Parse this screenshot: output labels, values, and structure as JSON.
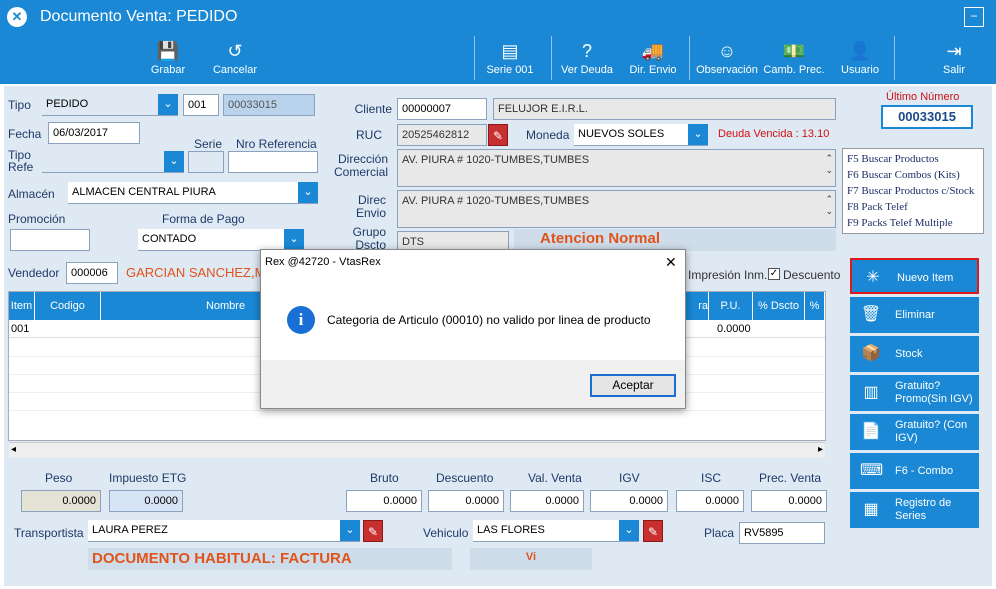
{
  "window": {
    "title": "Documento Venta: PEDIDO"
  },
  "toolbar": {
    "grabar": "Grabar",
    "cancelar": "Cancelar",
    "serie": "Serie 001",
    "ver_deuda": "Ver Deuda",
    "dir_envio": "Dir. Envio",
    "observacion": "Observación",
    "camb_prec": "Camb. Prec.",
    "usuario": "Usuario",
    "salir": "Salir"
  },
  "form": {
    "tipo_label": "Tipo",
    "tipo_value": "PEDIDO",
    "serie_value": "001",
    "numero_value": "00033015",
    "fecha_label": "Fecha",
    "fecha_value": "06/03/2017",
    "serie_label": "Serie",
    "nro_ref_label": "Nro Referencia",
    "tipo_refe_label": "Tipo Refe",
    "almacen_label": "Almacén",
    "almacen_value": "ALMACEN CENTRAL PIURA",
    "promocion_label": "Promoción",
    "forma_pago_label": "Forma de Pago",
    "forma_pago_value": "CONTADO",
    "cliente_label": "Cliente",
    "cliente_code": "00000007",
    "cliente_name": "FELUJOR E.I.R.L.",
    "ruc_label": "RUC",
    "ruc_value": "20525462812",
    "moneda_label": "Moneda",
    "moneda_value": "NUEVOS SOLES",
    "deuda": "Deuda Vencida : 13.10",
    "dir_comercial_label": "Dirección Comercial",
    "dir_comercial_value": "AV. PIURA # 1020-TUMBES,TUMBES",
    "direc_envio_label": "Direc Envio",
    "direc_envio_value": "AV. PIURA # 1020-TUMBES,TUMBES",
    "grupo_dscto_label": "Grupo Dscto",
    "grupo_dscto_value": "DTS",
    "atencion": "Atencion Normal",
    "vendedor_label": "Vendedor",
    "vendedor_code": "000006",
    "vendedor_name": "GARCIAN SANCHEZ,MIG",
    "impresion_label": "Impresión Inm.",
    "descuento_label": "Descuento"
  },
  "ultimo": {
    "label": "Último Número",
    "value": "00033015"
  },
  "shortcuts": [
    "F5 Buscar Productos",
    "F6 Buscar Combos (Kits)",
    "F7 Buscar Productos c/Stock",
    "F8 Pack Telef",
    "F9 Packs Telef Multiple"
  ],
  "side_buttons": {
    "nuevo_item": "Nuevo Item",
    "eliminar": "Eliminar",
    "stock": "Stock",
    "gratuito_promo": "Gratuito? Promo(Sin IGV)",
    "gratuito_con": "Gratuito? (Con IGV)",
    "combo": "F6 - Combo",
    "registro_series": "Registro de Series"
  },
  "grid": {
    "headers": [
      "Item",
      "Codigo",
      "Nombre",
      "ra",
      "P.U.",
      "% Dscto",
      "% D"
    ],
    "row": {
      "item": "001",
      "pu": "0.0000"
    }
  },
  "totals": {
    "peso_label": "Peso",
    "peso": "0.0000",
    "impuesto_label": "Impuesto ETG",
    "impuesto": "0.0000",
    "bruto_label": "Bruto",
    "bruto": "0.0000",
    "descuento_label": "Descuento",
    "descuento": "0.0000",
    "val_venta_label": "Val. Venta",
    "val_venta": "0.0000",
    "igv_label": "IGV",
    "igv": "0.0000",
    "isc_label": "ISC",
    "isc": "0.0000",
    "prec_venta_label": "Prec. Venta",
    "prec_venta": "0.0000"
  },
  "footer": {
    "transportista_label": "Transportista",
    "transportista": "LAURA PEREZ",
    "vehiculo_label": "Vehiculo",
    "vehiculo": "LAS FLORES",
    "placa_label": "Placa",
    "placa": "RV5895",
    "doc_habitual": "DOCUMENTO HABITUAL: FACTURA",
    "vi": "Vi"
  },
  "dialog": {
    "title": "Rex @42720 - VtasRex",
    "message": "Categoria de Articulo (00010) no valido por linea de producto",
    "accept": "Aceptar",
    "close": "✕"
  },
  "colors": {
    "accent": "#1a88d4",
    "alert": "#e0531a",
    "deuda": "#d01010"
  }
}
